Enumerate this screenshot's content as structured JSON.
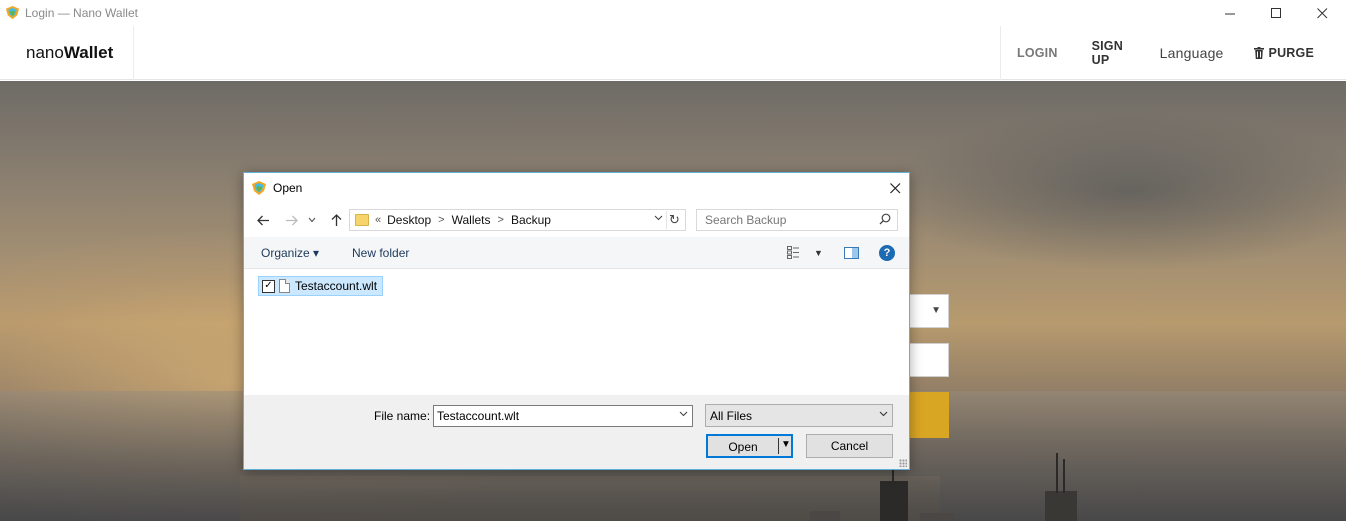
{
  "window": {
    "title": "Login — Nano Wallet",
    "icons": {
      "logo": "nem-logo-icon",
      "minimize": "minimize-icon",
      "maximize": "maximize-icon",
      "close": "close-icon"
    }
  },
  "app_nav": {
    "brand_light": "nano",
    "brand_bold": "Wallet",
    "links": {
      "login": "LOGIN",
      "signup": "SIGN UP",
      "language": "Language",
      "purge": "PURGE"
    },
    "purge_icon": "trash-icon"
  },
  "colors": {
    "accent_button": "#d9a623",
    "dialog_border": "#5fb0d8",
    "selection_bg": "#cce8ff",
    "primary_focus": "#0078d7",
    "help_blue": "#1c6bb3"
  },
  "dialog": {
    "title": "Open",
    "breadcrumb": {
      "lead": "«",
      "items": [
        "Desktop",
        "Wallets",
        "Backup"
      ]
    },
    "search": {
      "placeholder": "Search Backup"
    },
    "toolbar": {
      "organize": "Organize ▾",
      "new_folder": "New folder"
    },
    "files": [
      {
        "name": "Testaccount.wlt",
        "checked": true,
        "selected": true
      }
    ],
    "file_name_label": "File name:",
    "file_name_value": "Testaccount.wlt",
    "file_type": "All Files",
    "buttons": {
      "open": "Open",
      "cancel": "Cancel"
    }
  }
}
